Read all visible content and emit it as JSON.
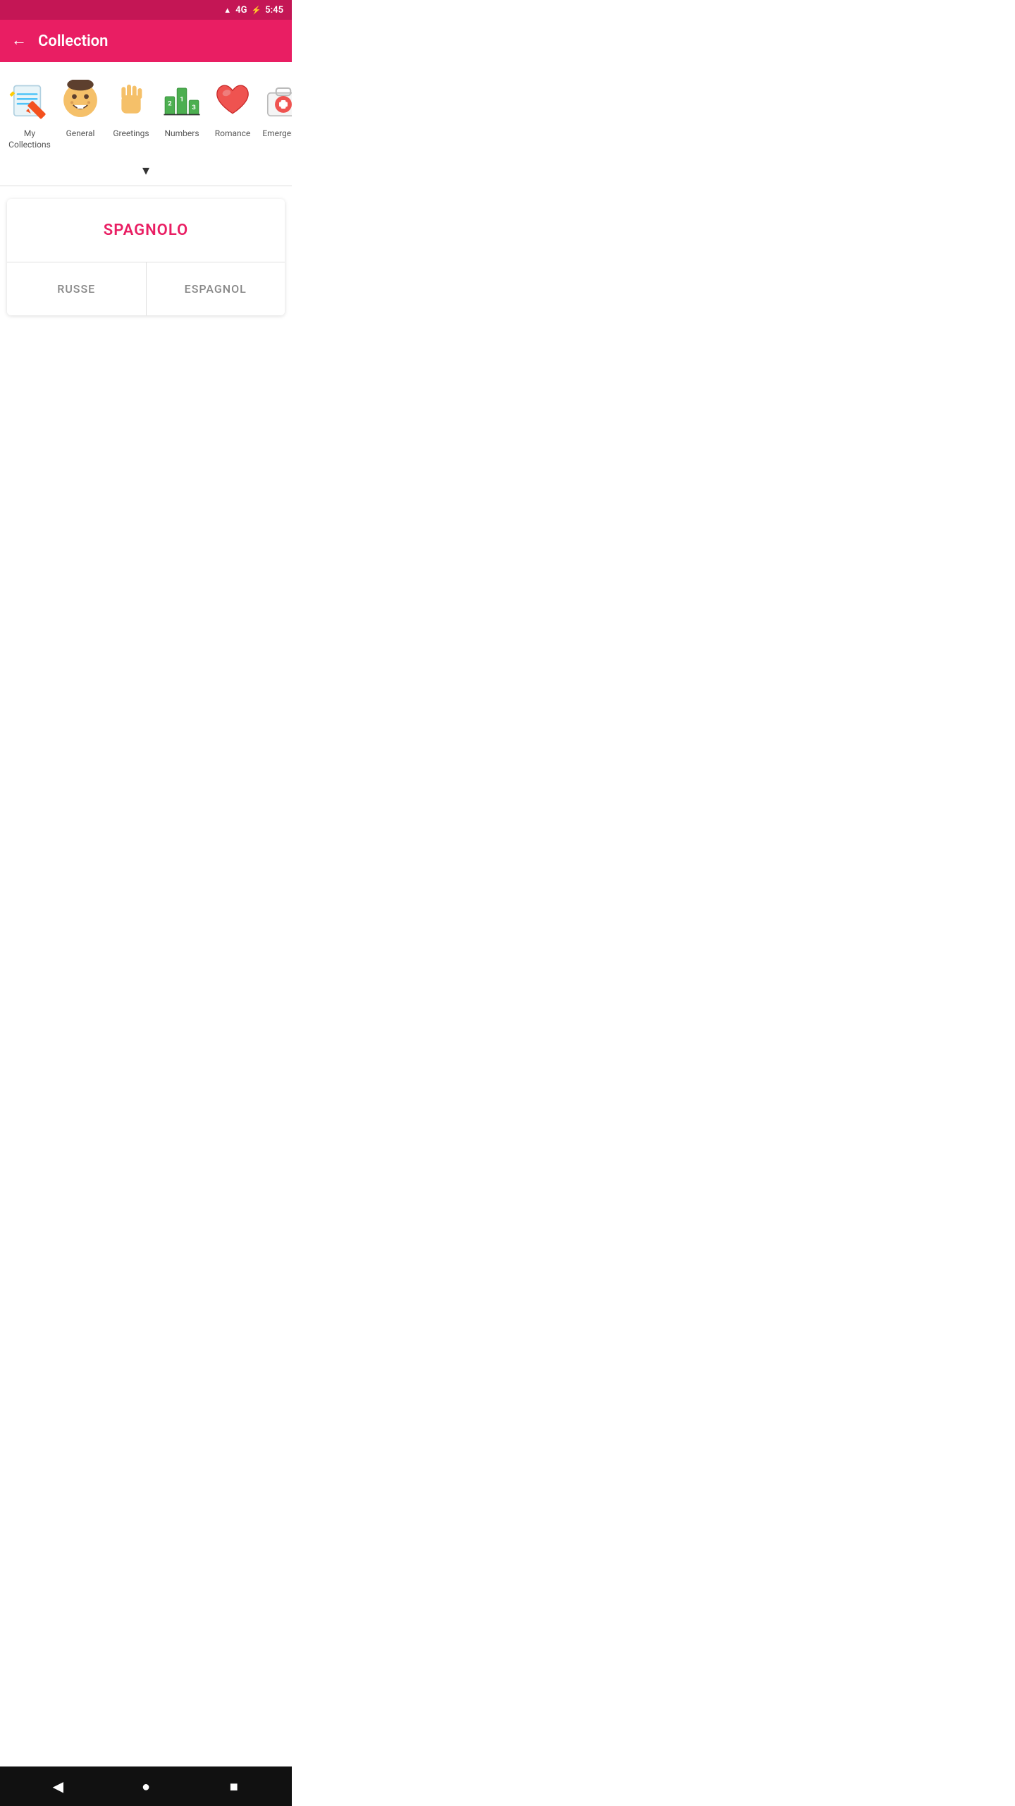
{
  "statusBar": {
    "network": "4G",
    "time": "5:45"
  },
  "header": {
    "title": "Collection",
    "backLabel": "←"
  },
  "categories": [
    {
      "id": "my-collections",
      "label": "My Collections",
      "icon": "pencil-notepad"
    },
    {
      "id": "general",
      "label": "General",
      "icon": "face-emoji"
    },
    {
      "id": "greetings",
      "label": "Greetings",
      "icon": "hand-wave"
    },
    {
      "id": "numbers",
      "label": "Numbers",
      "icon": "numbers-podium"
    },
    {
      "id": "romance",
      "label": "Romance",
      "icon": "heart"
    },
    {
      "id": "emergency",
      "label": "Emergency",
      "icon": "first-aid"
    }
  ],
  "chevron": "▾",
  "languageCard": {
    "topLabel": "SPAGNOLO",
    "leftOption": "RUSSE",
    "rightOption": "ESPAGNOL"
  },
  "bottomNav": {
    "backBtn": "◀",
    "homeBtn": "●",
    "recentBtn": "■"
  }
}
